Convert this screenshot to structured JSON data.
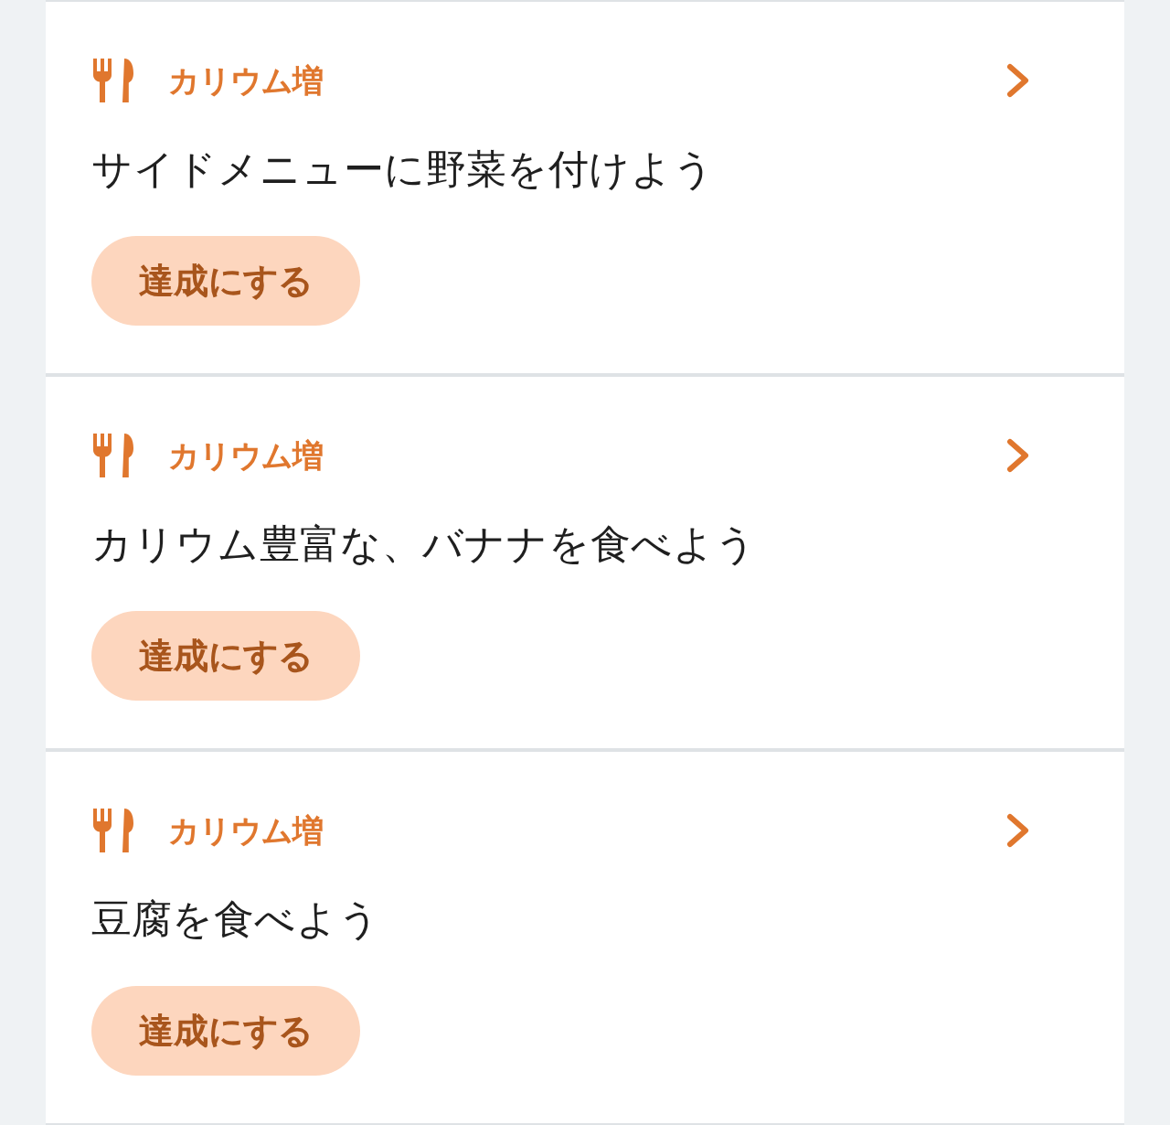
{
  "cards": [
    {
      "category": "カリウム増",
      "title": "サイドメニューに野菜を付けよう",
      "action": "達成にする"
    },
    {
      "category": "カリウム増",
      "title": "カリウム豊富な、バナナを食べよう",
      "action": "達成にする"
    },
    {
      "category": "カリウム増",
      "title": "豆腐を食べよう",
      "action": "達成にする"
    }
  ]
}
